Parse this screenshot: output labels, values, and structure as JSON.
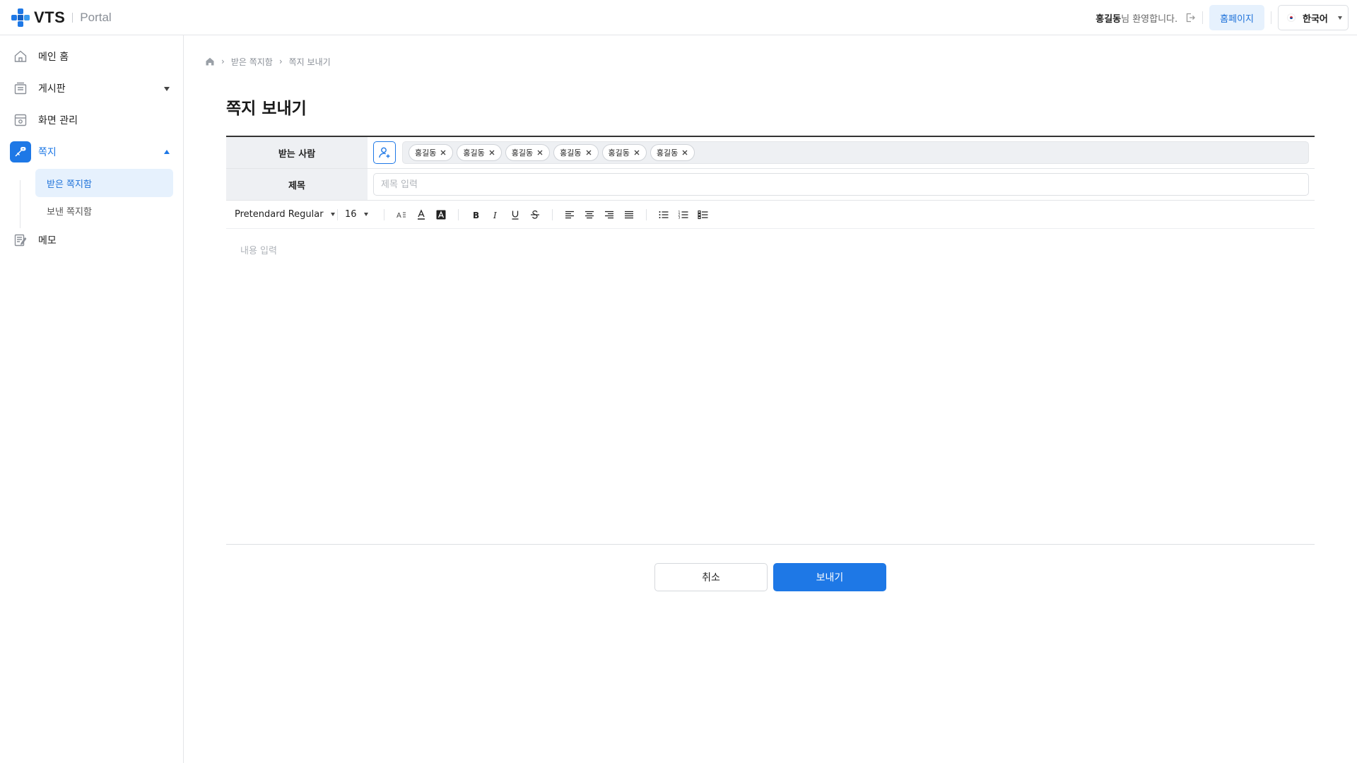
{
  "header": {
    "logo_text": "VTS",
    "logo_sub": "Portal",
    "user_name": "홍길동",
    "welcome_suffix": "님 환영합니다.",
    "homepage_label": "홈페이지",
    "language": "한국어"
  },
  "sidebar": {
    "items": [
      {
        "label": "메인 홈",
        "icon": "home-icon"
      },
      {
        "label": "게시판",
        "icon": "board-icon"
      },
      {
        "label": "화면 관리",
        "icon": "screen-icon"
      },
      {
        "label": "쪽지",
        "icon": "message-icon"
      },
      {
        "label": "메모",
        "icon": "memo-icon"
      }
    ],
    "sub_items": [
      {
        "label": "받은 쪽지함"
      },
      {
        "label": "보낸 쪽지함"
      }
    ]
  },
  "breadcrumb": [
    "받은 쪽지함",
    "쪽지 보내기"
  ],
  "page_title": "쪽지 보내기",
  "form": {
    "recipient_label": "받는 사람",
    "recipients": [
      "홍길동",
      "홍길동",
      "홍길동",
      "홍길동",
      "홍길동",
      "홍길동"
    ],
    "subject_label": "제목",
    "subject_placeholder": "제목 입력",
    "font_family": "Pretendard Regular",
    "font_size": "16",
    "content_placeholder": "내용 입력"
  },
  "actions": {
    "cancel": "취소",
    "send": "보내기"
  },
  "colors": {
    "accent": "#1e78e6",
    "accent_light": "#e6f1fd"
  }
}
